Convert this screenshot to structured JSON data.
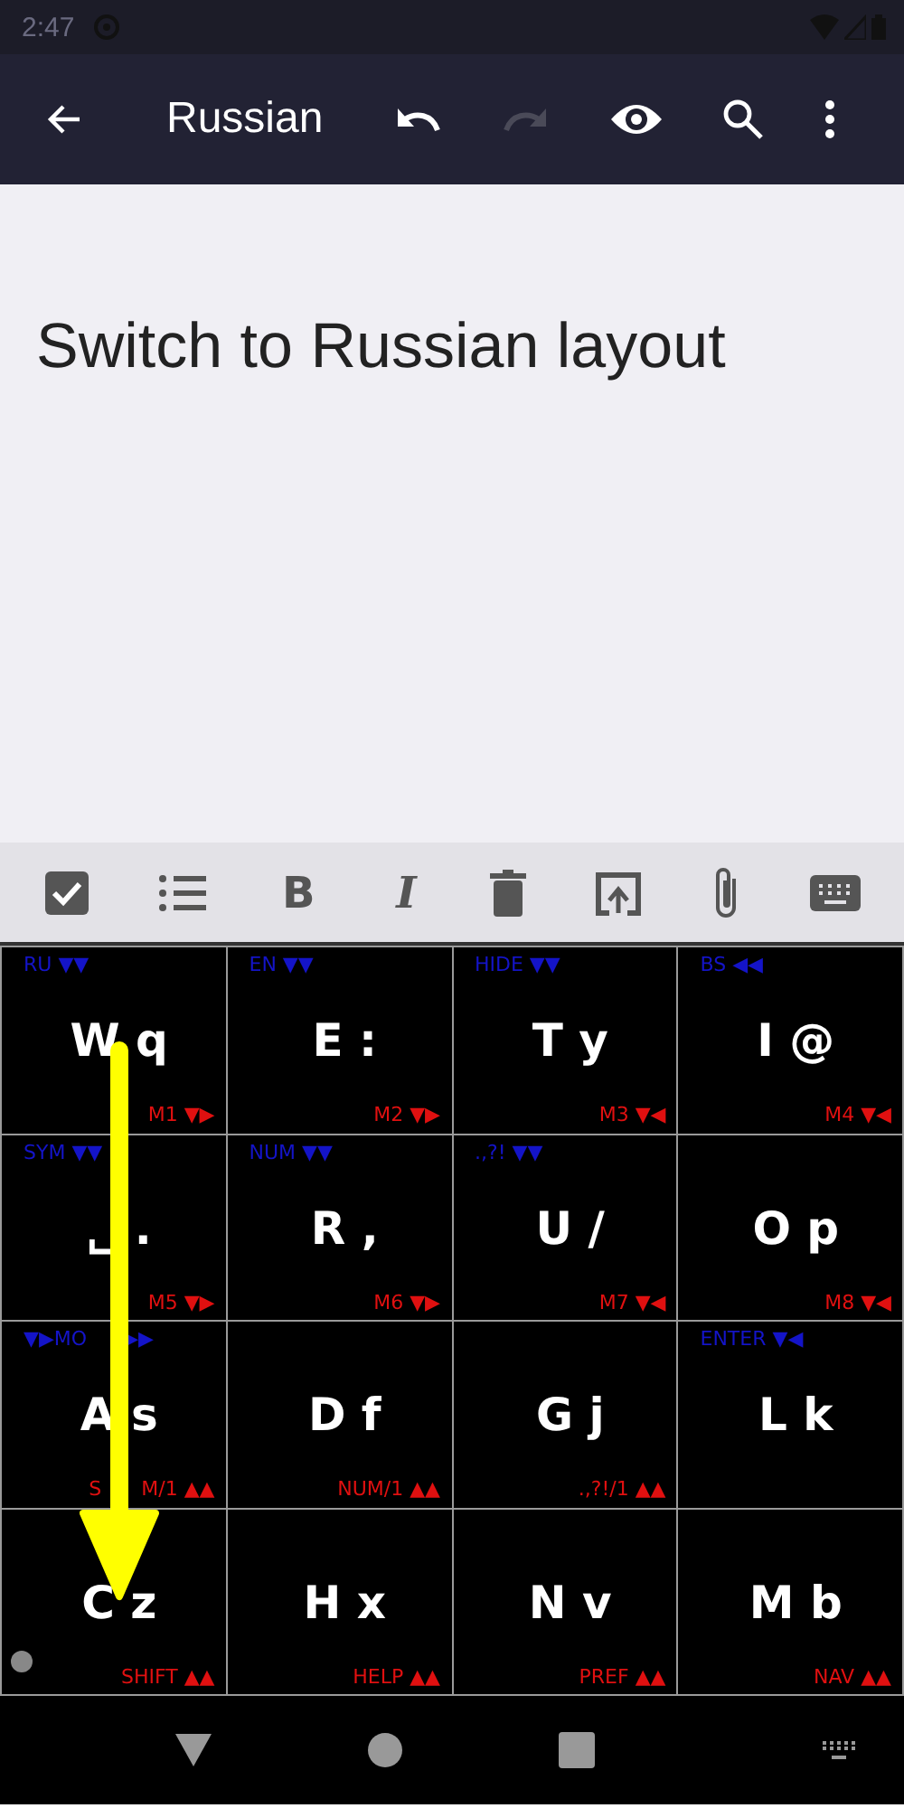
{
  "status_bar": {
    "time": "2:47"
  },
  "app_bar": {
    "title": "Russian",
    "redo_disabled": true
  },
  "editor": {
    "text": "Switch to Russian layout"
  },
  "format_toolbar": {
    "bold_label": "B",
    "italic_label": "I"
  },
  "keyboard": {
    "keys": [
      {
        "top": "RU ▼▼",
        "main": "W q",
        "bottom": "M1 ▼▶"
      },
      {
        "top": "EN ▼▼",
        "main": "E :",
        "bottom": "M2 ▼▶"
      },
      {
        "top": "HIDE ▼▼",
        "main": "T y",
        "bottom": "M3 ▼◀"
      },
      {
        "top": "BS ◀◀",
        "main": "I @",
        "bottom": "M4 ▼◀"
      },
      {
        "top": "SYM ▼▼",
        "main": "␣ .",
        "bottom": "M5 ▼▶"
      },
      {
        "top": "NUM ▼▼",
        "main": "R ,",
        "bottom": "M6 ▼▶"
      },
      {
        "top": ".,?! ▼▼",
        "main": "U /",
        "bottom": "M7 ▼◀"
      },
      {
        "main": "O p",
        "bottom": "M8 ▼◀"
      },
      {
        "top": [
          "▼▶MO",
          "▶▶"
        ],
        "main": "A s",
        "bottom": [
          "S",
          "M/1 ▲▲"
        ]
      },
      {
        "main": "D f",
        "bottom": "NUM/1 ▲▲"
      },
      {
        "main": "G j",
        "bottom": ".,?!/1 ▲▲"
      },
      {
        "top": "ENTER ▼◀",
        "main": "L k"
      },
      {
        "main": "C z",
        "bottom": "SHIFT ▲▲",
        "indicator": true
      },
      {
        "main": "H x",
        "bottom": "HELP ▲▲"
      },
      {
        "main": "N v",
        "bottom": "PREF ▲▲"
      },
      {
        "main": "M b",
        "bottom": "NAV ▲▲"
      }
    ],
    "swipe_arrow": true
  }
}
